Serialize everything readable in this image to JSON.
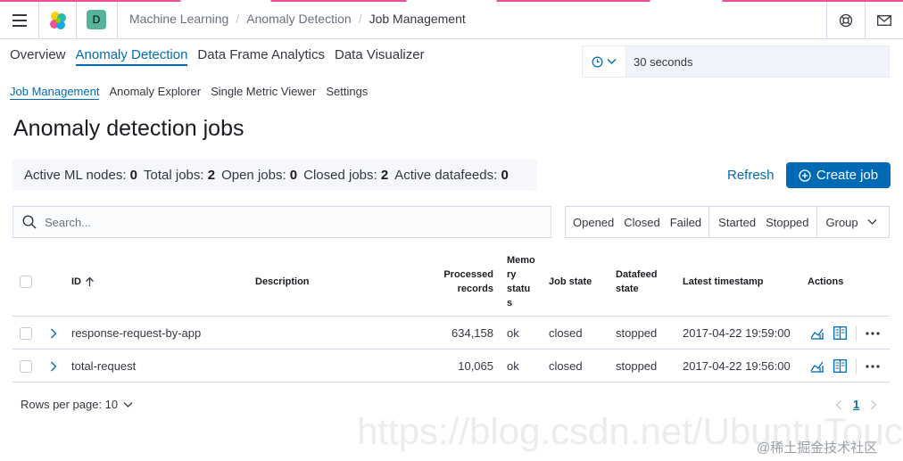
{
  "header": {
    "space_initial": "D",
    "breadcrumbs": [
      "Machine Learning",
      "Anomaly Detection",
      "Job Management"
    ],
    "icons": [
      "menu-icon",
      "elastic-logo-icon",
      "help-icon",
      "mail-icon"
    ]
  },
  "main_tabs": [
    "Overview",
    "Anomaly Detection",
    "Data Frame Analytics",
    "Data Visualizer"
  ],
  "active_main_tab": "Anomaly Detection",
  "refresh_interval": {
    "value": "30 seconds"
  },
  "sub_tabs": [
    "Job Management",
    "Anomaly Explorer",
    "Single Metric Viewer",
    "Settings"
  ],
  "active_sub_tab": "Job Management",
  "page_title": "Anomaly detection jobs",
  "stats": {
    "active_ml_nodes_label": "Active ML nodes:",
    "active_ml_nodes": "0",
    "total_jobs_label": "Total jobs:",
    "total_jobs": "2",
    "open_jobs_label": "Open jobs:",
    "open_jobs": "0",
    "closed_jobs_label": "Closed jobs:",
    "closed_jobs": "2",
    "active_datafeeds_label": "Active datafeeds:",
    "active_datafeeds": "0"
  },
  "actions": {
    "refresh": "Refresh",
    "create_job": "Create job"
  },
  "search": {
    "placeholder": "Search..."
  },
  "filters": {
    "state": [
      "Opened",
      "Closed",
      "Failed"
    ],
    "datafeed": [
      "Started",
      "Stopped"
    ],
    "group": "Group"
  },
  "table": {
    "columns": {
      "id": "ID",
      "description": "Description",
      "processed_records_1": "Processed",
      "processed_records_2": "records",
      "memory_1": "Memo",
      "memory_2": "ry",
      "memory_3": "statu",
      "memory_4": "s",
      "job_state": "Job state",
      "datafeed_1": "Datafeed",
      "datafeed_2": "state",
      "latest_timestamp": "Latest timestamp",
      "actions": "Actions"
    },
    "rows": [
      {
        "id": "response-request-by-app",
        "description": "",
        "processed_records": "634,158",
        "memory_status": "ok",
        "job_state": "closed",
        "datafeed_state": "stopped",
        "latest_timestamp": "2017-04-22 19:59:00"
      },
      {
        "id": "total-request",
        "description": "",
        "processed_records": "10,065",
        "memory_status": "ok",
        "job_state": "closed",
        "datafeed_state": "stopped",
        "latest_timestamp": "2017-04-22 19:56:00"
      }
    ]
  },
  "pagination": {
    "rows_per_page": "Rows per page: 10",
    "current_page": "1"
  },
  "watermark": {
    "url": "https://blog.csdn.net/UbuntuTouch",
    "site": "@稀土掘金技术社区"
  }
}
